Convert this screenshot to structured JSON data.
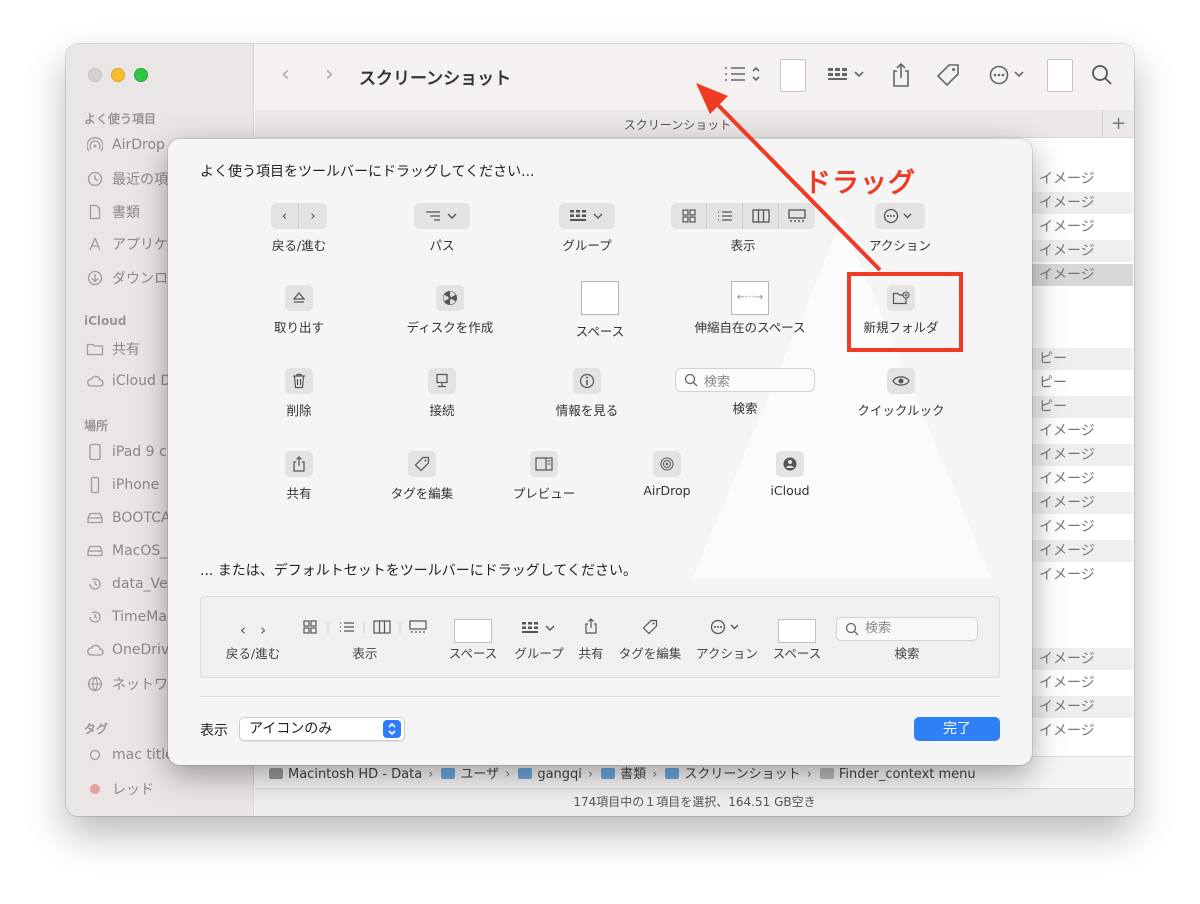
{
  "sidebar": {
    "sections": {
      "favorites": "よく使う項目",
      "icloud": "iCloud",
      "locations": "場所",
      "tags": "タグ"
    },
    "items": [
      {
        "label": "AirDrop",
        "icon": "airdrop-icon"
      },
      {
        "label": "最近の項",
        "icon": "clock-icon"
      },
      {
        "label": "書類",
        "icon": "document-icon"
      },
      {
        "label": "アプリケ",
        "icon": "applications-icon"
      },
      {
        "label": "ダウンロ",
        "icon": "download-icon"
      },
      {
        "label": "共有",
        "icon": "shared-folder-icon"
      },
      {
        "label": "iCloud D",
        "icon": "cloud-icon"
      },
      {
        "label": "iPad 9 c",
        "icon": "ipad-icon"
      },
      {
        "label": "iPhone",
        "icon": "iphone-icon"
      },
      {
        "label": "BOOTCA",
        "icon": "disk-icon"
      },
      {
        "label": "MacOS_",
        "icon": "disk-icon"
      },
      {
        "label": "data_Ve",
        "icon": "timemachine-icon"
      },
      {
        "label": "TimeMa",
        "icon": "timemachine-icon"
      },
      {
        "label": "OneDriv",
        "icon": "cloud-icon"
      },
      {
        "label": "ネットワ",
        "icon": "network-icon"
      },
      {
        "label": "mac title",
        "icon": "tag-circle-icon"
      },
      {
        "label": "レッド",
        "icon": "tag-red-icon"
      }
    ],
    "colors": {
      "red_tag": "#e84b43"
    }
  },
  "toolbar": {
    "title": "スクリーンショット",
    "tab_label": "スクリーンショット",
    "tab_plus": "+"
  },
  "file_list": [
    "イメージ",
    "イメージ",
    "イメージ",
    "イメージ",
    "イメージ",
    "ピー",
    "ピー",
    "ピー",
    "イメージ",
    "イメージ",
    "イメージ",
    "イメージ",
    "イメージ",
    "イメージ",
    "イメージ",
    "イメージ",
    "イメージ",
    "イメージ",
    "イメージ"
  ],
  "pathbar": {
    "segments": [
      "Macintosh HD - Data",
      "ユーザ",
      "gangqi",
      "書類",
      "スクリーンショット",
      "Finder_context menu"
    ],
    "separator": "›"
  },
  "status": "174項目中の１項目を選択、164.51 GB空き",
  "sheet": {
    "heading": "よく使う項目をツールバーにドラッグしてください...",
    "items": {
      "back_forward": "戻る/進む",
      "path": "パス",
      "group": "グループ",
      "view": "表示",
      "action": "アクション",
      "eject": "取り出す",
      "burn": "ディスクを作成",
      "space": "スペース",
      "flexible_space": "伸縮自在のスペース",
      "new_folder": "新規フォルダ",
      "delete": "削除",
      "connect": "接続",
      "get_info": "情報を見る",
      "search": "検索",
      "search_placeholder": "検索",
      "quick_look": "クイックルック",
      "share": "共有",
      "edit_tags": "タグを編集",
      "preview": "プレビュー",
      "airdrop": "AirDrop",
      "icloud": "iCloud"
    },
    "default_heading": "... または、デフォルトセットをツールバーにドラッグしてください。",
    "default_set": {
      "back_forward": "戻る/進む",
      "view": "表示",
      "space": "スペース",
      "group": "グループ",
      "share": "共有",
      "edit_tags": "タグを編集",
      "action": "アクション",
      "space2": "スペース",
      "search": "検索",
      "search_placeholder": "検索"
    },
    "show_label": "表示",
    "show_value": "アイコンのみ",
    "done": "完了",
    "colors": {
      "accent": "#2f80f5"
    }
  },
  "annotation": {
    "text": "ドラッグ",
    "color": "#ef3a24"
  }
}
